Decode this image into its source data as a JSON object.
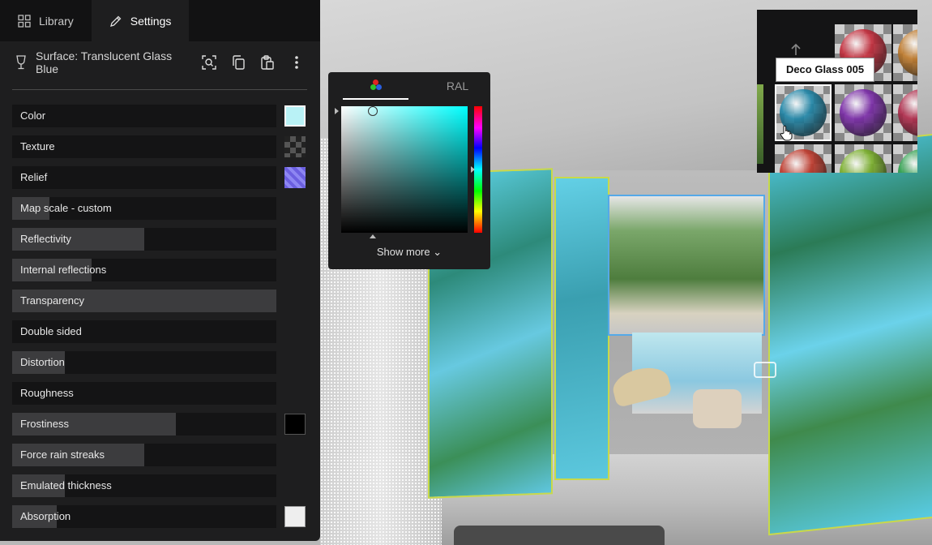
{
  "tabs": [
    {
      "label": "Library",
      "icon": "grid-icon"
    },
    {
      "label": "Settings",
      "icon": "pencil-icon"
    }
  ],
  "surface": {
    "title": "Surface: Translucent Glass Blue",
    "icon": "wine-glass-icon",
    "tools": [
      "search-icon",
      "copy-icon",
      "paste-icon",
      "more-vertical-icon"
    ]
  },
  "properties": [
    {
      "label": "Color",
      "level": 0,
      "swatch": "color",
      "swatch_color": "#b9f2f6"
    },
    {
      "label": "Texture",
      "level": 0,
      "swatch": "texture"
    },
    {
      "label": "Relief",
      "level": 0,
      "swatch": "relief"
    },
    {
      "label": "Map scale - custom",
      "level": 0.14
    },
    {
      "label": "Reflectivity",
      "level": 0.5
    },
    {
      "label": "Internal reflections",
      "level": 0.3
    },
    {
      "label": "Transparency",
      "level": 1.0
    },
    {
      "label": "Double sided",
      "level": 0
    },
    {
      "label": "Distortion",
      "level": 0.2
    },
    {
      "label": "Roughness",
      "level": 0
    },
    {
      "label": "Frostiness",
      "level": 0.62,
      "swatch": "black",
      "swatch_color": "#000000"
    },
    {
      "label": "Force rain streaks",
      "level": 0.5
    },
    {
      "label": "Emulated thickness",
      "level": 0.2
    },
    {
      "label": "Absorption",
      "level": 0.17,
      "swatch": "absorb",
      "swatch_color": "#eeeeee"
    }
  ],
  "picker": {
    "tab_rgb_icon": "rgb-circles-icon",
    "tab_ral": "RAL",
    "hue_color": "#00ffff",
    "show_more": "Show more ⌄"
  },
  "library": {
    "tooltip": "Deco Glass 005",
    "up_icon": "arrow-up-icon",
    "thumbs": [
      {
        "color": "#c42b3a"
      },
      {
        "color": "#c07a2a"
      },
      {
        "color": "#1f86a8",
        "selected": true
      },
      {
        "color": "#7a2aa8"
      },
      {
        "color": "#b02a4a"
      },
      {
        "color": "#c0392b"
      },
      {
        "color": "#7ab02a"
      },
      {
        "color": "#2aa04a"
      }
    ]
  }
}
